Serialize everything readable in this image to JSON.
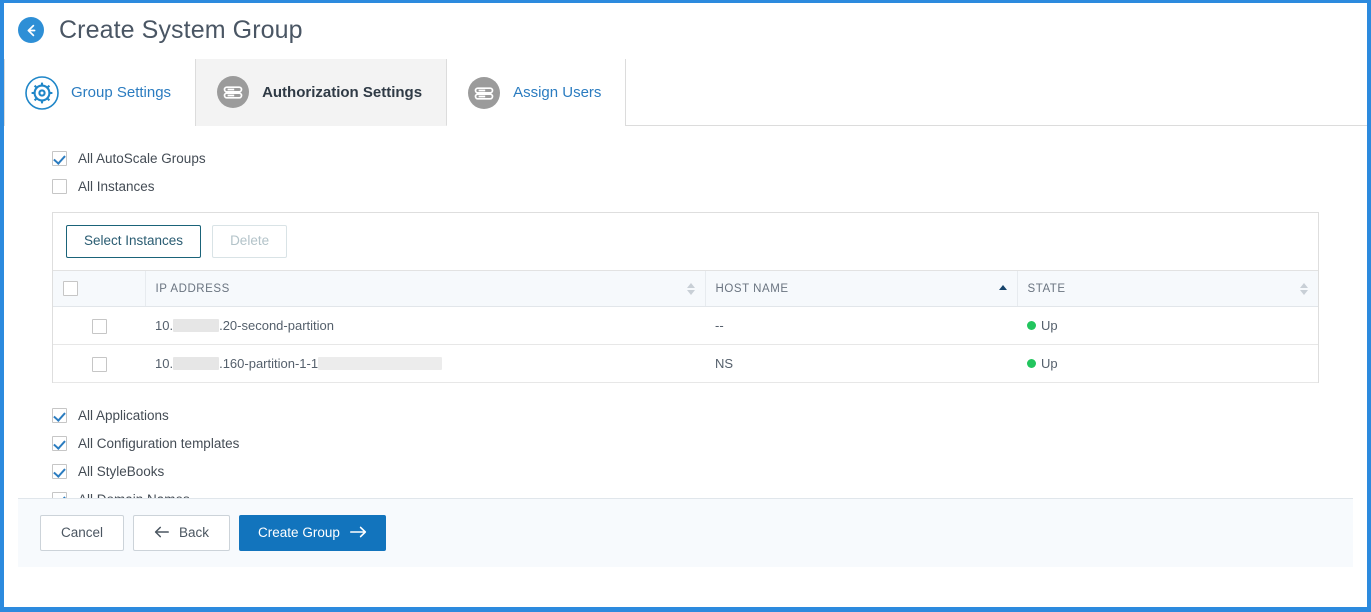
{
  "header": {
    "back_icon": "back-arrow-icon",
    "title": "Create System Group"
  },
  "tabs": [
    {
      "id": "group-settings",
      "label": "Group Settings",
      "icon": "gear-icon",
      "active": false
    },
    {
      "id": "authorization-settings",
      "label": "Authorization Settings",
      "icon": "server-icon",
      "active": true
    },
    {
      "id": "assign-users",
      "label": "Assign Users",
      "icon": "server-icon",
      "active": false
    }
  ],
  "top_checkboxes": [
    {
      "id": "all-autoscale-groups",
      "label": "All AutoScale Groups",
      "checked": true
    },
    {
      "id": "all-instances",
      "label": "All Instances",
      "checked": false
    }
  ],
  "instances_panel": {
    "toolbar": {
      "select_instances_label": "Select Instances",
      "delete_label": "Delete",
      "delete_disabled": true
    },
    "columns": [
      {
        "key": "select",
        "label": "",
        "sort": "none"
      },
      {
        "key": "ip",
        "label": "IP ADDRESS",
        "sort": "none"
      },
      {
        "key": "host",
        "label": "HOST NAME",
        "sort": "asc"
      },
      {
        "key": "state",
        "label": "STATE",
        "sort": "none"
      }
    ],
    "select_all_checked": false,
    "rows": [
      {
        "checked": false,
        "ip_prefix": "10.",
        "ip_redacted_width": 46,
        "ip_suffix": ".20-second-partition",
        "ip_trailing_redacted_width": 0,
        "host": "--",
        "state": "Up",
        "state_color": "#22c55e"
      },
      {
        "checked": false,
        "ip_prefix": "10.",
        "ip_redacted_width": 46,
        "ip_suffix": ".160-partition-1-1",
        "ip_trailing_redacted_width": 124,
        "host": "NS",
        "state": "Up",
        "state_color": "#22c55e"
      }
    ]
  },
  "bottom_checkboxes": [
    {
      "id": "all-applications",
      "label": "All Applications",
      "checked": true
    },
    {
      "id": "all-configuration-templates",
      "label": "All Configuration templates",
      "checked": true
    },
    {
      "id": "all-stylebooks",
      "label": "All StyleBooks",
      "checked": true
    },
    {
      "id": "all-domain-names",
      "label": "All Domain Names",
      "checked": true
    }
  ],
  "footer": {
    "cancel_label": "Cancel",
    "back_label": "Back",
    "create_label": "Create Group"
  },
  "theme": {
    "accent": "#1274bd",
    "frame_border": "#2c8ade",
    "link": "#2b7cc0",
    "status_up": "#22c55e"
  }
}
